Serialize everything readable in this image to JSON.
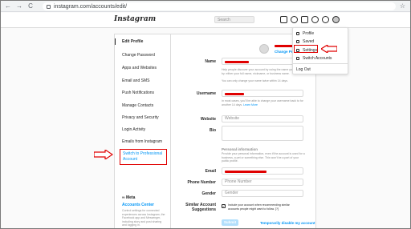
{
  "browser": {
    "back": "←",
    "forward": "→",
    "reload": "C",
    "url": "instagram.com/accounts/edit/",
    "star": "☆"
  },
  "header": {
    "logo": "Instagram",
    "search_placeholder": "Search",
    "icons": [
      "home-icon",
      "messenger-icon",
      "new-post-icon",
      "explore-icon",
      "activity-icon",
      "profile-avatar"
    ]
  },
  "dropdown": {
    "items": [
      "Profile",
      "Saved",
      "Settings",
      "Switch Accounts"
    ],
    "logout": "Log Out"
  },
  "sidebar": {
    "items": [
      "Edit Profile",
      "Change Password",
      "Apps and Websites",
      "Email and SMS",
      "Push Notifications",
      "Manage Contacts",
      "Privacy and Security",
      "Login Activity",
      "Emails from Instagram"
    ],
    "switch_label": "Switch to Professional Account",
    "meta": "∞ Meta",
    "accounts_center": "Accounts Center",
    "accounts_center_desc": "Control settings for connected experiences across Instagram, the Facebook app and Messenger, including story and post sharing and logging in."
  },
  "form": {
    "change_photo": "Change Profile Photo",
    "name_label": "Name",
    "name_note": "Help people discover your account by using the name you're known by: either your full name, nickname, or business name.",
    "name_note2": "You can only change your name twice within 14 days.",
    "username_label": "Username",
    "username_note": "In most cases, you'll be able to change your username back to",
    "username_note_tail": "for another 14 days.",
    "learn_more": "Learn More",
    "website_label": "Website",
    "website_placeholder": "Website",
    "bio_label": "Bio",
    "personal_title": "Personal information",
    "personal_note": "Provide your personal information, even if the account is used for a business, a pet or something else. This won't be a part of your public profile.",
    "email_label": "Email",
    "phone_label": "Phone Number",
    "phone_placeholder": "Phone Number",
    "gender_label": "Gender",
    "gender_placeholder": "Gender",
    "similar_label": "Similar Account Suggestions",
    "similar_text": "Include your account when recommending similar accounts people might want to follow.",
    "similar_help": "[?]",
    "check_mark": "✓",
    "submit": "Submit",
    "disable": "Temporarily disable my account"
  },
  "colors": {
    "annotation_red": "#e00000",
    "link_blue": "#0095f6",
    "border": "#dbdbdb"
  }
}
